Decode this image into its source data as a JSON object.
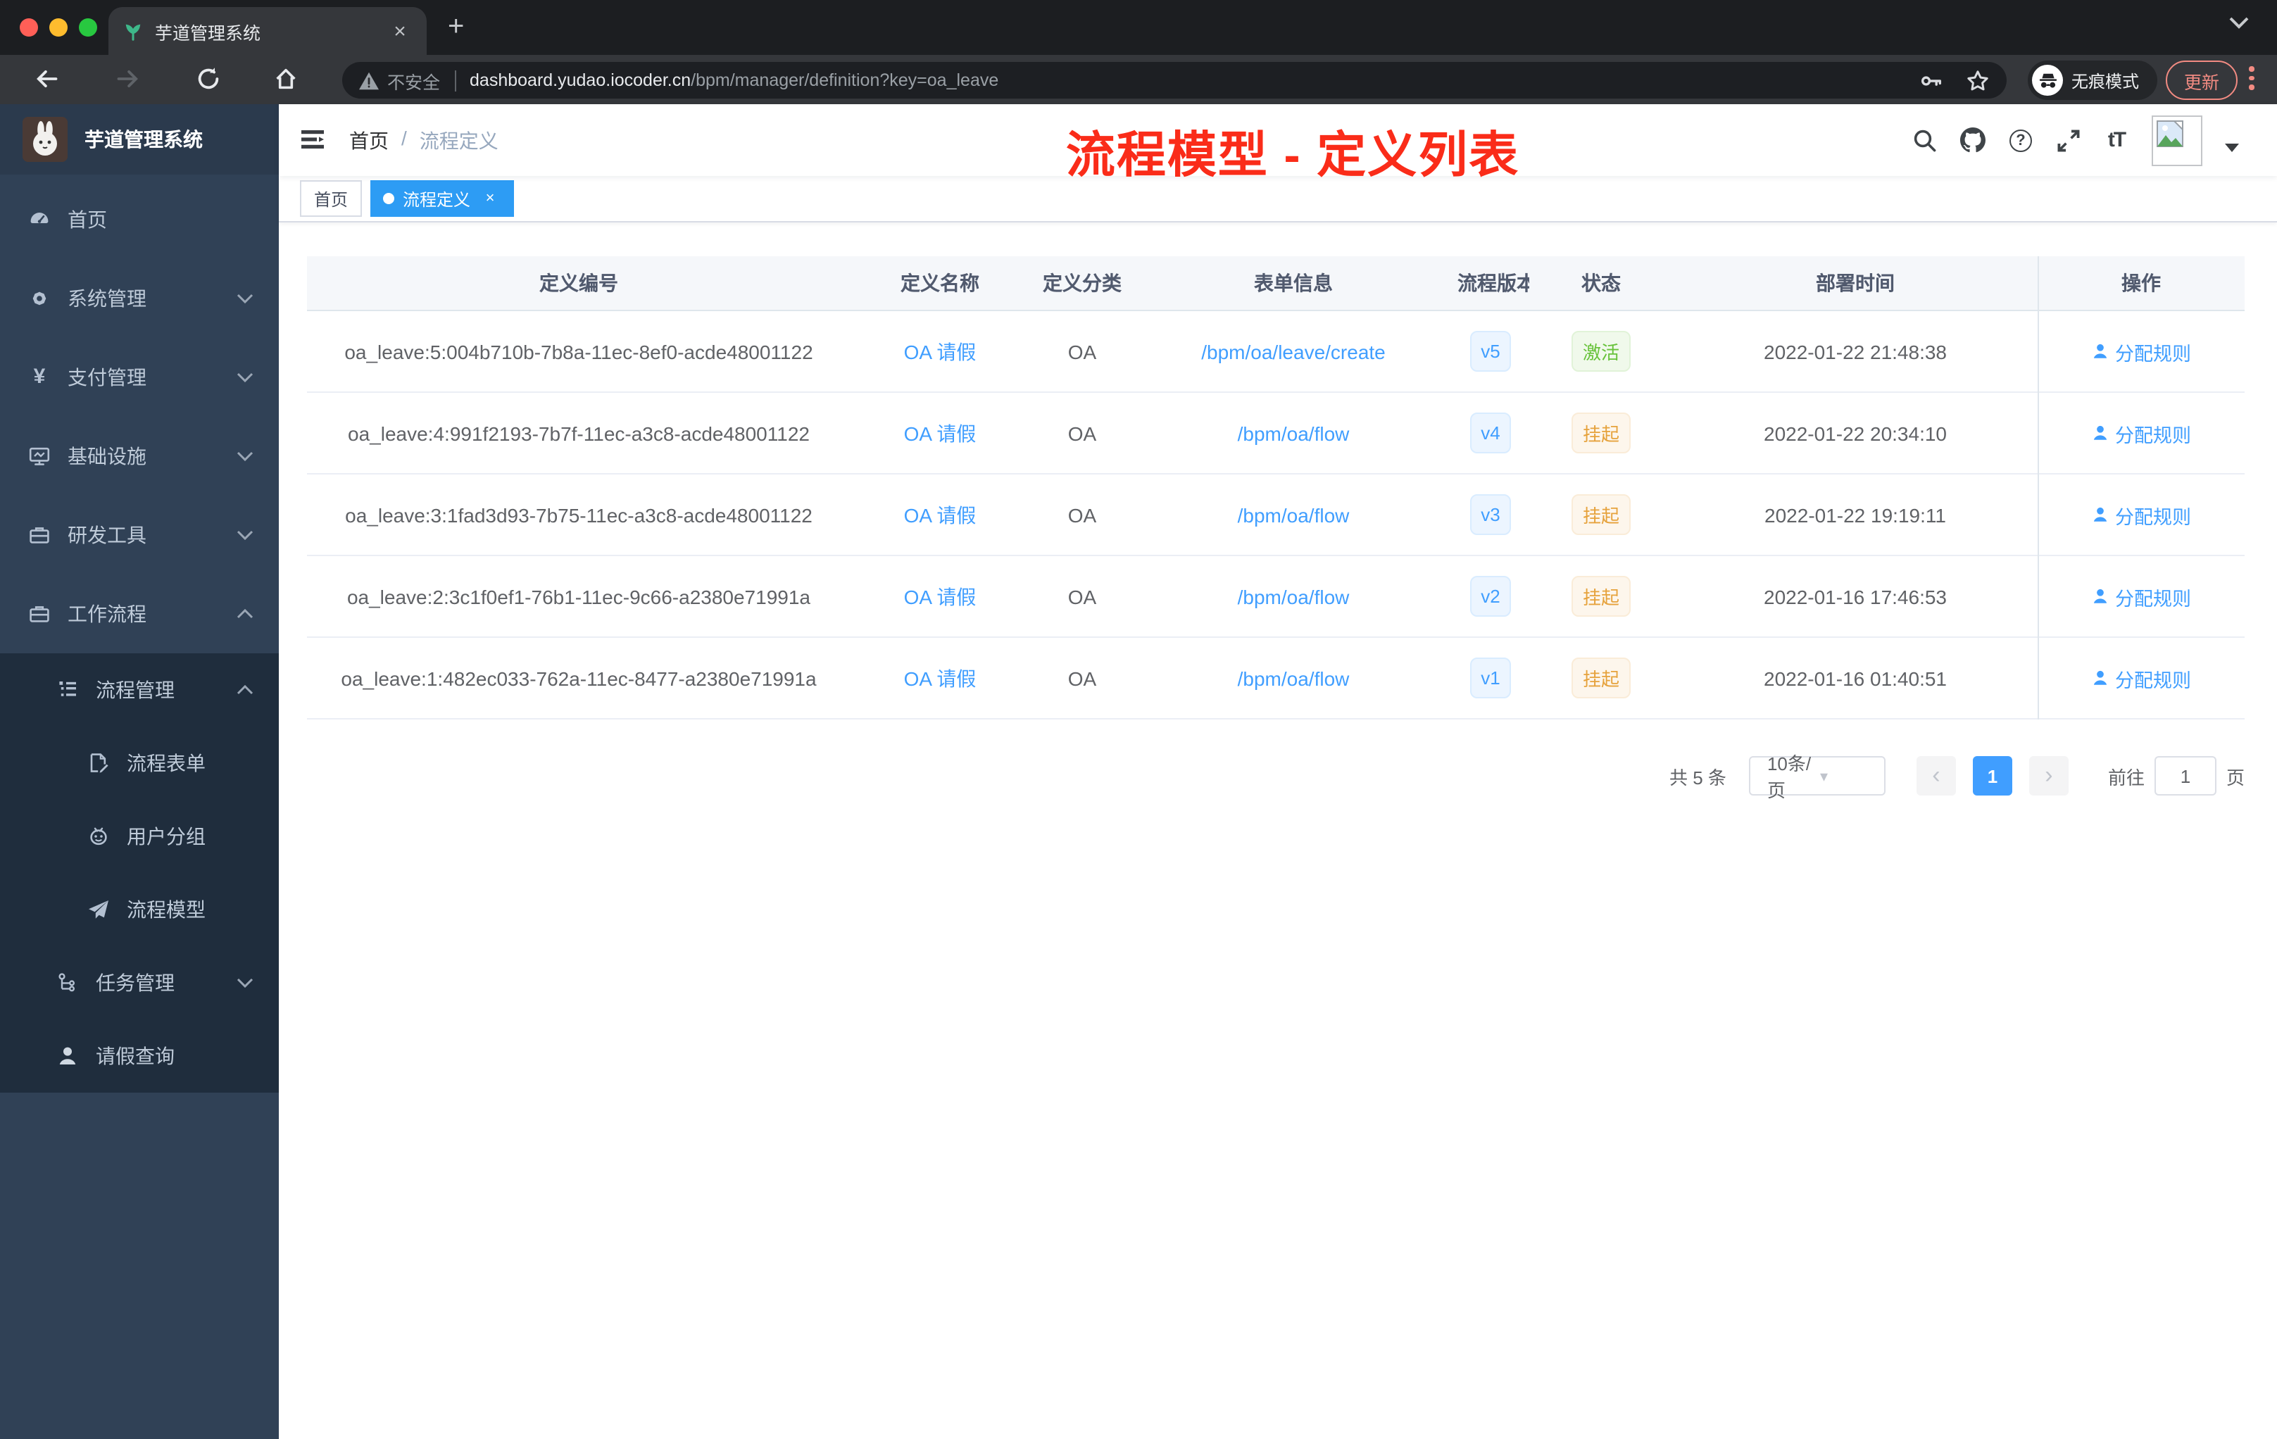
{
  "browser": {
    "tab": {
      "title": "芋道管理系统"
    },
    "toolbar": {
      "security_label": "不安全",
      "url_host": "dashboard.yudao.iocoder.cn",
      "url_path": "/bpm/manager/definition?key=oa_leave",
      "incognito_label": "无痕模式",
      "update_label": "更新"
    }
  },
  "icons": {
    "tab_close": "×",
    "new_tab": "+",
    "tag_close": "×",
    "breadcrumb_separator": "/",
    "question_mark": "?",
    "text_size": "tT",
    "yen": "¥",
    "select_caret": "▾",
    "prev_arrow": "‹",
    "next_arrow": "›"
  },
  "sidebar": {
    "title": "芋道管理系统",
    "items": [
      {
        "label": "首页"
      },
      {
        "label": "系统管理"
      },
      {
        "label": "支付管理"
      },
      {
        "label": "基础设施"
      },
      {
        "label": "研发工具"
      },
      {
        "label": "工作流程"
      },
      {
        "label": "流程管理"
      },
      {
        "label": "流程表单"
      },
      {
        "label": "用户分组"
      },
      {
        "label": "流程模型"
      },
      {
        "label": "任务管理"
      },
      {
        "label": "请假查询"
      }
    ]
  },
  "navbar": {
    "breadcrumb": [
      "首页",
      "流程定义"
    ],
    "annotation": "流程模型 - 定义列表"
  },
  "tags_view": {
    "tags": [
      {
        "label": "首页",
        "active": false
      },
      {
        "label": "流程定义",
        "active": true
      }
    ]
  },
  "table": {
    "columns": [
      "定义编号",
      "定义名称",
      "定义分类",
      "表单信息",
      "流程版本",
      "状态",
      "部署时间",
      "操作"
    ],
    "rows": [
      {
        "id": "oa_leave:5:004b710b-7b8a-11ec-8ef0-acde48001122",
        "name": "OA 请假",
        "category": "OA",
        "form": "/bpm/oa/leave/create",
        "version": "v5",
        "status": "激活",
        "deploy_time": "2022-01-22 21:48:38",
        "action": "分配规则"
      },
      {
        "id": "oa_leave:4:991f2193-7b7f-11ec-a3c8-acde48001122",
        "name": "OA 请假",
        "category": "OA",
        "form": "/bpm/oa/flow",
        "version": "v4",
        "status": "挂起",
        "deploy_time": "2022-01-22 20:34:10",
        "action": "分配规则"
      },
      {
        "id": "oa_leave:3:1fad3d93-7b75-11ec-a3c8-acde48001122",
        "name": "OA 请假",
        "category": "OA",
        "form": "/bpm/oa/flow",
        "version": "v3",
        "status": "挂起",
        "deploy_time": "2022-01-22 19:19:11",
        "action": "分配规则"
      },
      {
        "id": "oa_leave:2:3c1f0ef1-76b1-11ec-9c66-a2380e71991a",
        "name": "OA 请假",
        "category": "OA",
        "form": "/bpm/oa/flow",
        "version": "v2",
        "status": "挂起",
        "deploy_time": "2022-01-16 17:46:53",
        "action": "分配规则"
      },
      {
        "id": "oa_leave:1:482ec033-762a-11ec-8477-a2380e71991a",
        "name": "OA 请假",
        "category": "OA",
        "form": "/bpm/oa/flow",
        "version": "v1",
        "status": "挂起",
        "deploy_time": "2022-01-16 01:40:51",
        "action": "分配规则"
      }
    ]
  },
  "pagination": {
    "total_label": "共 5 条",
    "page_size": "10条/页",
    "current_page": "1",
    "goto_label": "前往",
    "goto_value": "1",
    "page_unit": "页"
  },
  "colors": {
    "accent_blue": "#409eff",
    "tag_active_blue": "#2d9cf4",
    "success_green": "#67c23a",
    "warning_orange": "#e6a23c",
    "annotation_red": "#fa2c19",
    "sidebar_bg": "#304156",
    "submenu_bg": "#1f2d3d",
    "traffic_red": "#ff5f57",
    "traffic_yellow": "#febc2e",
    "traffic_green": "#28c840"
  }
}
